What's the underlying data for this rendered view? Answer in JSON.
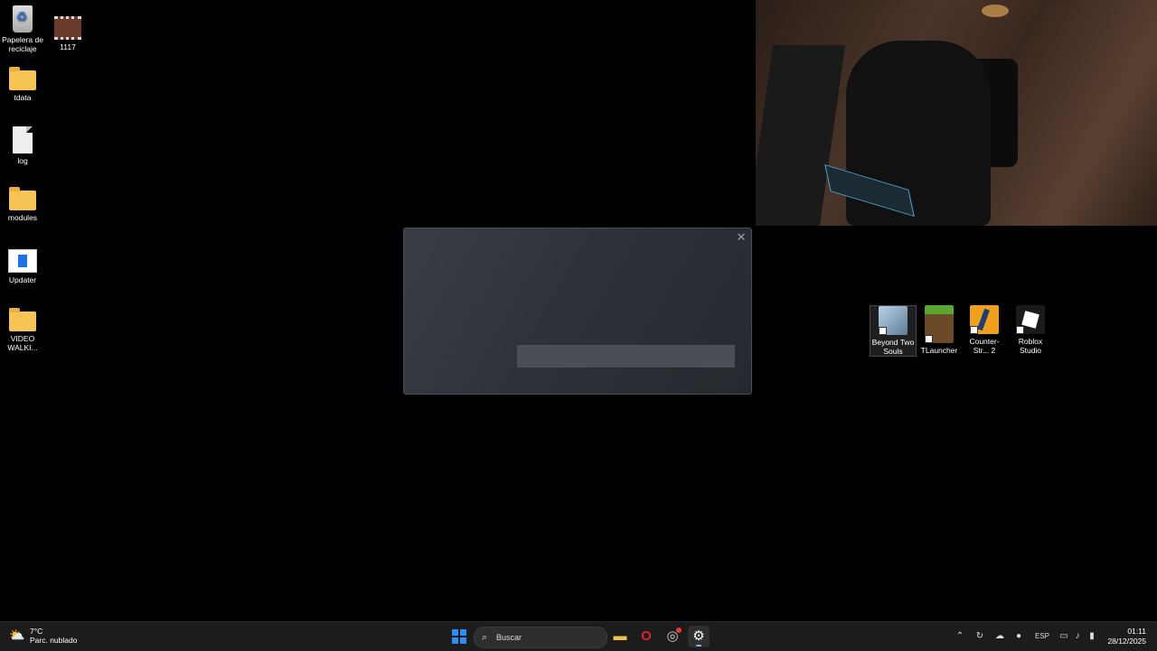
{
  "desktop_icons": [
    {
      "label": "Papelera de reciclaje",
      "icon": "recycle-bin-icon"
    },
    {
      "label": "1117",
      "icon": "video-file-icon"
    },
    {
      "label": "tdata",
      "icon": "folder-icon"
    },
    {
      "label": "log",
      "icon": "text-file-icon"
    },
    {
      "label": "modules",
      "icon": "folder-icon"
    },
    {
      "label": "Updater",
      "icon": "app-icon"
    },
    {
      "label": "VIDEO WALKI...",
      "icon": "folder-icon"
    }
  ],
  "shortcuts": [
    {
      "label": "Beyond Two Souls",
      "icon": "beyond-two-souls-icon"
    },
    {
      "label": "TLauncher",
      "icon": "tlauncher-icon"
    },
    {
      "label": "Counter-Str... 2",
      "icon": "counter-strike-icon"
    },
    {
      "label": "Roblox Studio",
      "icon": "roblox-studio-icon"
    }
  ],
  "dialog": {
    "close": "✕"
  },
  "taskbar": {
    "weather": {
      "temp": "7°C",
      "condition": "Parc. nublado"
    },
    "search": {
      "placeholder": "Buscar"
    },
    "tray": {
      "language": "ESP"
    },
    "clock": {
      "time": "01:11",
      "date": "28/12/2025"
    }
  }
}
